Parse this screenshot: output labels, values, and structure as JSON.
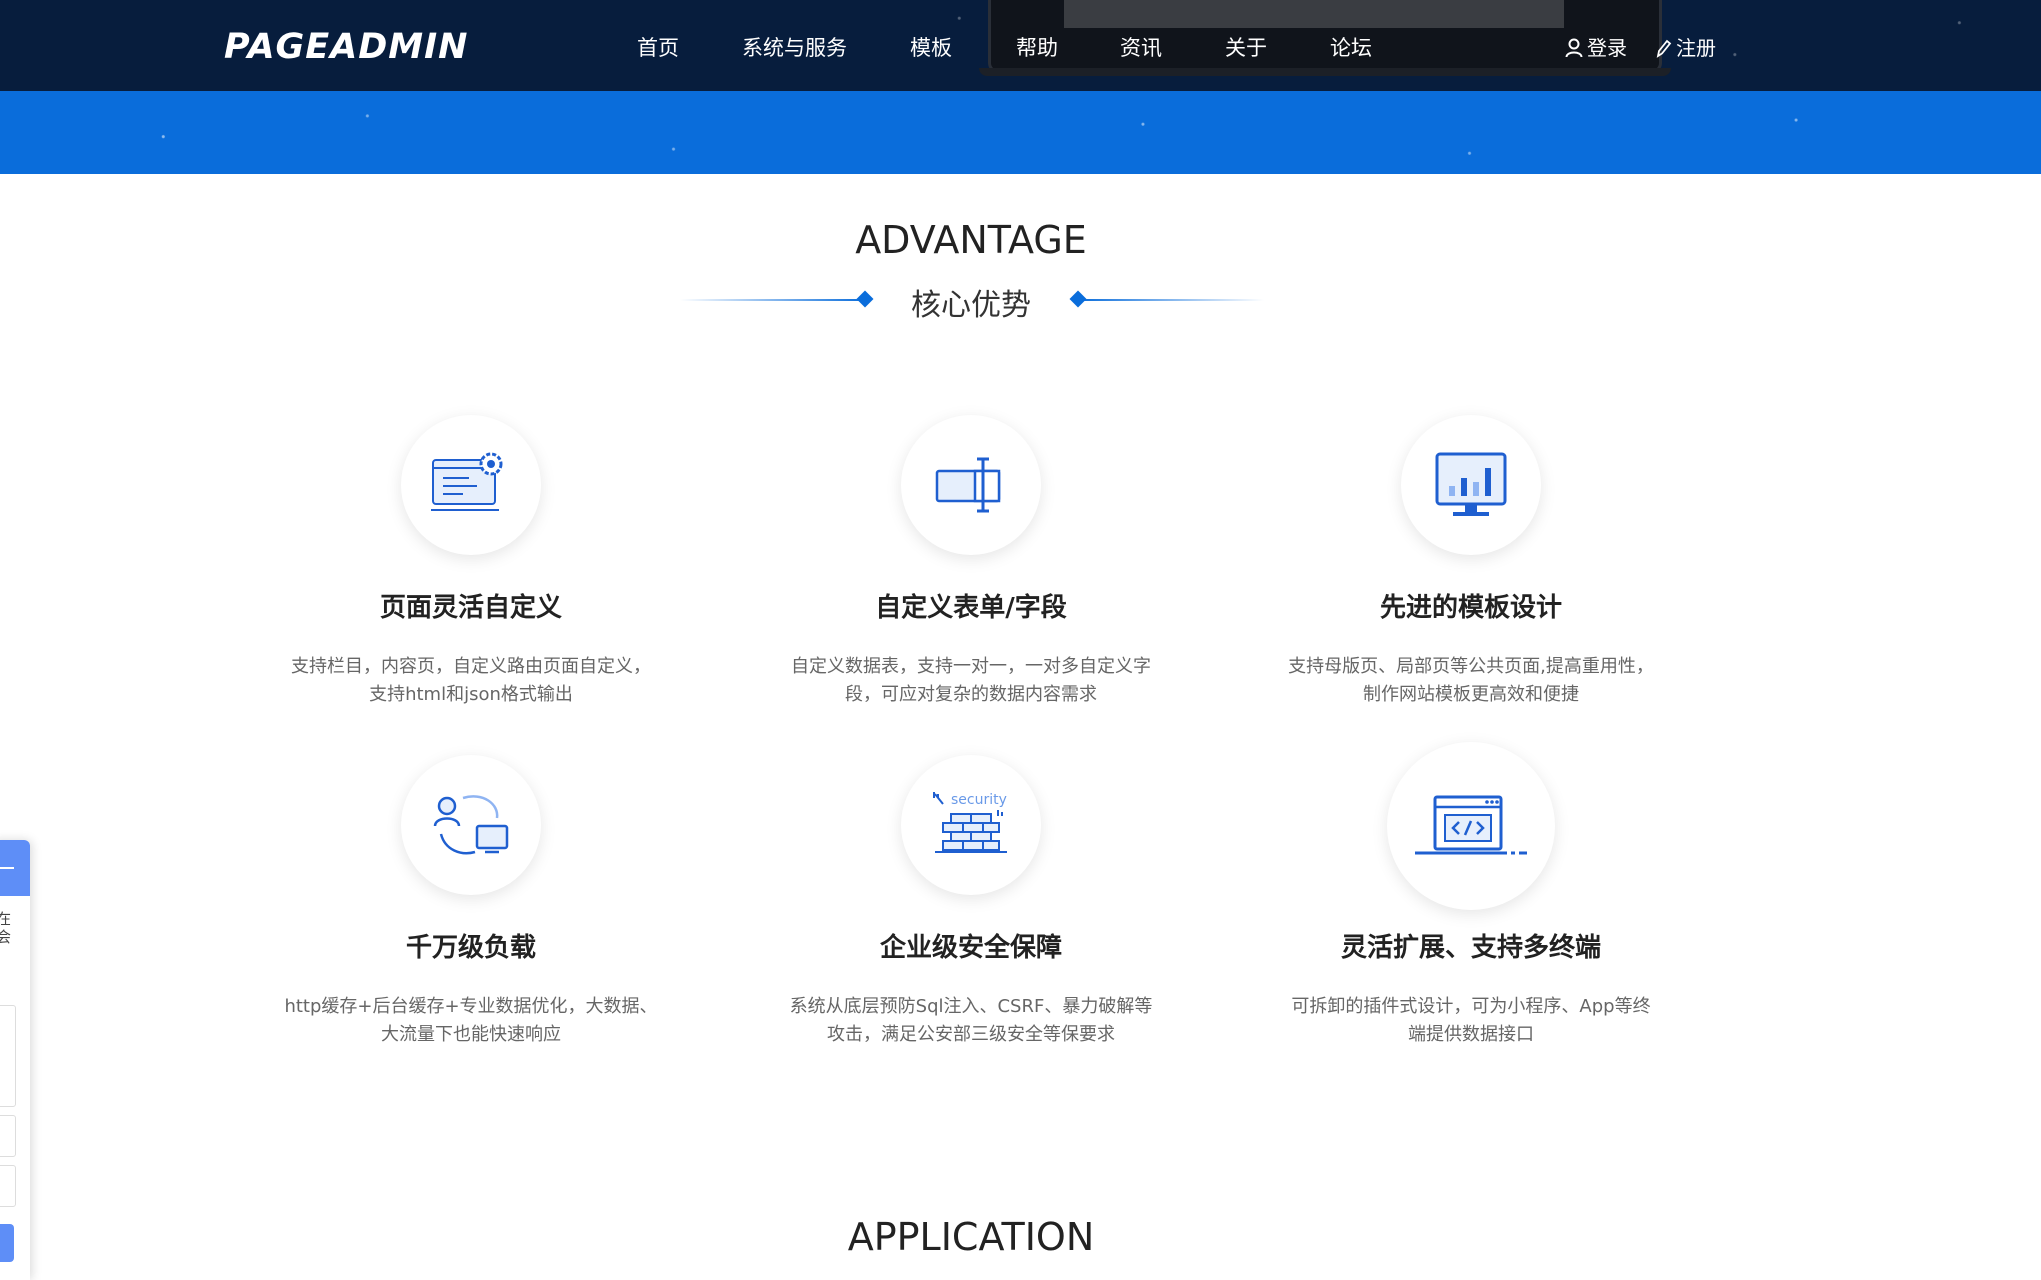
{
  "header": {
    "logo": "PAGEADMIN",
    "nav": [
      "首页",
      "系统与服务",
      "模板",
      "帮助",
      "资讯",
      "关于",
      "论坛"
    ],
    "login": "登录",
    "register": "注册"
  },
  "advantage": {
    "title": "ADVANTAGE",
    "subtitle": "核心优势",
    "features": [
      {
        "icon": "settings-page-icon",
        "title": "页面灵活自定义",
        "desc1": "支持栏目，内容页，自定义路由页面自定义，",
        "desc2": "支持html和json格式输出"
      },
      {
        "icon": "form-field-icon",
        "title": "自定义表单/字段",
        "desc1": "自定义数据表，支持一对一，一对多自定义字",
        "desc2": "段，可应对复杂的数据内容需求"
      },
      {
        "icon": "monitor-chart-icon",
        "title": "先进的模板设计",
        "desc1": "支持母版页、局部页等公共页面,提高重用性，",
        "desc2": "制作网站模板更高效和便捷"
      },
      {
        "icon": "user-load-icon",
        "title": "千万级负载",
        "desc1": "http缓存+后台缓存+专业数据优化，大数据、",
        "desc2": "大流量下也能快速响应"
      },
      {
        "icon": "security-wall-icon",
        "title": "企业级安全保障",
        "desc1": "系统从底层预防Sql注入、CSRF、暴力破解等",
        "desc2": "攻击，满足公安部三级安全等保要求"
      },
      {
        "icon": "code-window-icon",
        "title": "灵活扩展、支持多终端",
        "desc1": "可拆卸的插件式设计，可为小程序、App等终",
        "desc2": "端提供数据接口"
      }
    ]
  },
  "application": {
    "title": "APPLICATION"
  },
  "side_widget": {
    "text": "在\n会"
  },
  "colors": {
    "header_bg": "#071d3d",
    "banner_bg": "#0a6ddb",
    "accent": "#0a6ddb",
    "widget_accent": "#5e8ef7"
  }
}
